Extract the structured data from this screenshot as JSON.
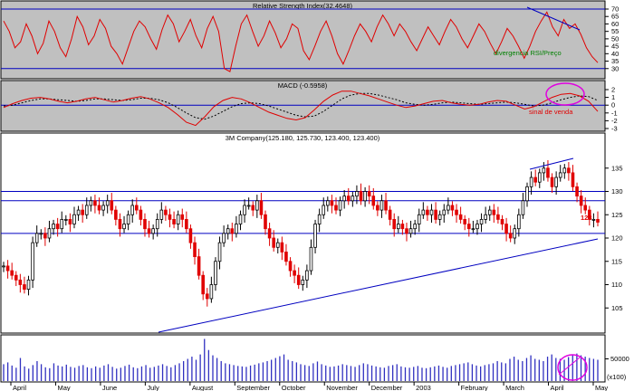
{
  "chart_data": [
    {
      "panel": "rsi",
      "type": "line",
      "title": "Relative Strength Index(32.4648)",
      "ylim": [
        25,
        70
      ],
      "yticks": [
        30,
        35,
        40,
        45,
        50,
        55,
        60,
        65,
        70
      ],
      "reference_lines": [
        70,
        30
      ],
      "series": [
        {
          "values": [
            62,
            55,
            44,
            48,
            60,
            52,
            40,
            47,
            62,
            55,
            44,
            38,
            50,
            65,
            58,
            46,
            52,
            63,
            57,
            45,
            40,
            33,
            44,
            55,
            62,
            58,
            50,
            43,
            56,
            66,
            60,
            48,
            55,
            63,
            52,
            44,
            57,
            65,
            55,
            30,
            28,
            45,
            60,
            66,
            55,
            45,
            52,
            62,
            54,
            44,
            50,
            60,
            57,
            42,
            36,
            45,
            55,
            62,
            52,
            40,
            33,
            42,
            52,
            60,
            55,
            48,
            58,
            66,
            60,
            52,
            60,
            55,
            48,
            42,
            50,
            58,
            52,
            46,
            55,
            63,
            58,
            50,
            44,
            52,
            60,
            55,
            47,
            40,
            48,
            57,
            52,
            45,
            37,
            45,
            55,
            62,
            68,
            58,
            52,
            63,
            57,
            60,
            53,
            44,
            38,
            34
          ]
        }
      ],
      "annotations": [
        {
          "text": "divergencia RSI/Preço"
        }
      ]
    },
    {
      "panel": "macd",
      "type": "line",
      "title": "MACD (-0.5958)",
      "ylim": [
        -3,
        2
      ],
      "yticks": [
        2,
        1,
        0,
        -1,
        -2,
        -3
      ],
      "series": [
        {
          "style": "solid",
          "values": [
            -0.3,
            0.2,
            0.6,
            0.9,
            1.0,
            0.8,
            0.5,
            0.3,
            0.5,
            0.8,
            1.0,
            0.7,
            0.4,
            0.6,
            0.9,
            1.1,
            0.8,
            0.3,
            -0.3,
            -1.2,
            -2.2,
            -2.6,
            -1.5,
            -0.2,
            0.6,
            1.0,
            0.8,
            0.3,
            -0.3,
            -0.9,
            -1.3,
            -1.7,
            -1.9,
            -1.6,
            -0.6,
            0.5,
            1.3,
            1.8,
            1.8,
            1.5,
            1.2,
            0.8,
            0.4,
            0.0,
            -0.3,
            -0.1,
            0.2,
            0.5,
            0.6,
            0.3,
            0.1,
            0.0,
            0.1,
            0.4,
            0.6,
            0.5,
            0.0,
            -0.5,
            -0.2,
            0.4,
            1.0,
            1.4,
            1.5,
            1.2,
            0.5,
            -0.8
          ]
        },
        {
          "style": "dashed",
          "values": [
            -0.1,
            0.0,
            0.3,
            0.6,
            0.8,
            0.8,
            0.7,
            0.6,
            0.5,
            0.6,
            0.8,
            0.8,
            0.7,
            0.6,
            0.7,
            0.9,
            0.9,
            0.7,
            0.3,
            -0.3,
            -1.0,
            -1.6,
            -1.8,
            -1.4,
            -0.8,
            -0.2,
            0.2,
            0.3,
            0.2,
            -0.1,
            -0.5,
            -0.9,
            -1.3,
            -1.5,
            -1.4,
            -0.8,
            0.0,
            0.8,
            1.3,
            1.5,
            1.5,
            1.3,
            1.0,
            0.7,
            0.3,
            0.1,
            0.0,
            0.1,
            0.3,
            0.4,
            0.3,
            0.2,
            0.1,
            0.2,
            0.3,
            0.4,
            0.3,
            0.1,
            -0.1,
            0.0,
            0.3,
            0.7,
            1.0,
            1.2,
            1.1,
            0.6
          ]
        }
      ],
      "annotations": [
        {
          "text": "sinal de venda"
        }
      ]
    },
    {
      "panel": "price",
      "type": "candlestick",
      "title": "3M Company(125.180, 125.730, 123.400, 123.400)",
      "ylim": [
        100,
        140
      ],
      "yticks": [
        135,
        130,
        125,
        120,
        115,
        110,
        105
      ],
      "x_labels": [
        "April",
        "May",
        "June",
        "July",
        "August",
        "September",
        "October",
        "November",
        "December",
        "2003",
        "February",
        "March",
        "April",
        "May"
      ],
      "horizontal_levels": [
        130,
        128,
        121
      ],
      "label_128": "128",
      "close": [
        114,
        113,
        112,
        111,
        110,
        109,
        111,
        119,
        121,
        121,
        120,
        122,
        123,
        122,
        124,
        124,
        123,
        125,
        126,
        125,
        127,
        128,
        127,
        126,
        127,
        128,
        126,
        124,
        122,
        123,
        125,
        127,
        126,
        124,
        122,
        121,
        122,
        124,
        126,
        125,
        124,
        123,
        125,
        124,
        122,
        119,
        116,
        112,
        108,
        107,
        110,
        115,
        119,
        121,
        122,
        121,
        123,
        125,
        127,
        127,
        126,
        128,
        125,
        122,
        120,
        118,
        119,
        117,
        115,
        113,
        112,
        110,
        111,
        113,
        118,
        123,
        125,
        127,
        128,
        127,
        126,
        128,
        129,
        128,
        129,
        130,
        128,
        130,
        129,
        127,
        126,
        128,
        126,
        124,
        122,
        123,
        122,
        121,
        122,
        123,
        125,
        126,
        125,
        126,
        124,
        125,
        126,
        127,
        126,
        125,
        124,
        123,
        122,
        122,
        123,
        124,
        125,
        126,
        125,
        124,
        123,
        121,
        120,
        122,
        125,
        128,
        131,
        133,
        132,
        134,
        135,
        133,
        131,
        133,
        134,
        135,
        134,
        131,
        129,
        127,
        126,
        124,
        124,
        123.4
      ],
      "trendlines": [
        {
          "from": [
            "Jul",
            104
          ],
          "to": [
            "May",
            125
          ]
        },
        {
          "from": [
            "Apr",
            131
          ],
          "to": [
            "Apr",
            138
          ]
        }
      ]
    },
    {
      "panel": "volume",
      "type": "bar",
      "unit": "(x100)",
      "ylim": [
        0,
        100000
      ],
      "yticks": [
        50000
      ],
      "values": [
        38000,
        42000,
        35000,
        30000,
        52000,
        33000,
        28000,
        36000,
        45000,
        38000,
        31000,
        29000,
        40000,
        35000,
        33000,
        37000,
        32000,
        30000,
        34000,
        36000,
        31000,
        29000,
        33000,
        30000,
        35000,
        38000,
        32000,
        28000,
        30000,
        34000,
        37000,
        31000,
        29000,
        33000,
        36000,
        30000,
        32000,
        35000,
        38000,
        34000,
        31000,
        36000,
        40000,
        45000,
        50000,
        55000,
        48000,
        60000,
        95000,
        70000,
        58000,
        52000,
        45000,
        40000,
        38000,
        36000,
        34000,
        33000,
        32000,
        35000,
        37000,
        40000,
        42000,
        45000,
        48000,
        52000,
        56000,
        60000,
        48000,
        45000,
        42000,
        38000,
        36000,
        34000,
        40000,
        44000,
        38000,
        35000,
        32000,
        33000,
        35000,
        38000,
        36000,
        34000,
        32000,
        36000,
        40000,
        38000,
        35000,
        33000,
        31000,
        30000,
        34000,
        36000,
        38000,
        33000,
        31000,
        30000,
        32000,
        34000,
        30000,
        29000,
        31000,
        33000,
        35000,
        32000,
        30000,
        34000,
        36000,
        38000,
        40000,
        42000,
        38000,
        35000,
        33000,
        36000,
        38000,
        40000,
        45000,
        42000,
        40000,
        50000,
        55000,
        48000,
        45000,
        52000,
        58000,
        50000,
        48000,
        45000,
        55000,
        60000,
        52000,
        50000,
        48000,
        54000,
        60000,
        62000,
        58000,
        55000,
        52000,
        50000,
        48000
      ]
    }
  ]
}
